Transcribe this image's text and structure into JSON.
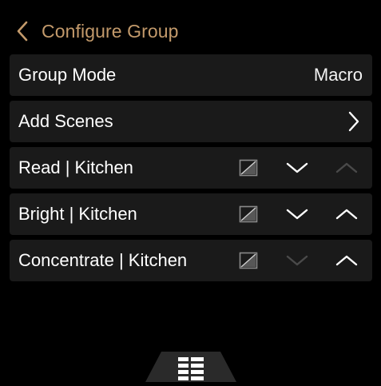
{
  "header": {
    "title": "Configure Group"
  },
  "group_mode": {
    "label": "Group Mode",
    "value": "Macro"
  },
  "add_scenes": {
    "label": "Add Scenes"
  },
  "scenes": [
    {
      "label": "Read | Kitchen",
      "down_enabled": true,
      "up_enabled": false
    },
    {
      "label": "Bright | Kitchen",
      "down_enabled": true,
      "up_enabled": true
    },
    {
      "label": "Concentrate | Kitchen",
      "down_enabled": false,
      "up_enabled": true
    }
  ],
  "colors": {
    "accent": "#c39a6b",
    "row_bg": "#1a1a1a",
    "enabled_icon": "#ffffff",
    "disabled_icon": "#4a4a4a",
    "image_icon": "#8a8a8a"
  },
  "icons": {
    "back": "chevron-left-icon",
    "forward": "chevron-right-icon",
    "scene_image": "image-placeholder-icon",
    "move_down": "chevron-down-icon",
    "move_up": "chevron-up-icon",
    "bottom_menu": "grid-menu-icon"
  }
}
